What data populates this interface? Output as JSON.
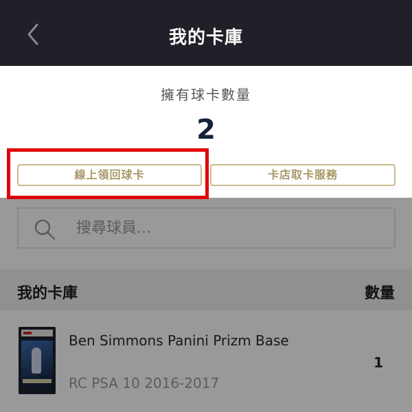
{
  "header": {
    "title": "我的卡庫",
    "back_icon": "chevron-left-icon"
  },
  "summary": {
    "owned_label": "擁有球卡數量",
    "owned_count": "2",
    "online_claim_label": "線上領回球卡",
    "store_service_label": "卡店取卡服務"
  },
  "search": {
    "placeholder": "搜尋球員...",
    "value": "",
    "icon": "search-icon"
  },
  "list": {
    "section_title": "我的卡庫",
    "quantity_header": "數量",
    "items": [
      {
        "name": "Ben Simmons Panini Prizm Base",
        "subtitle": "RC PSA 10 2016-2017",
        "quantity": "1"
      }
    ]
  },
  "colors": {
    "header_bg": "#202028",
    "accent_gold": "#c9b98b",
    "highlight_red": "#e0000a",
    "count_navy": "#14233a"
  }
}
